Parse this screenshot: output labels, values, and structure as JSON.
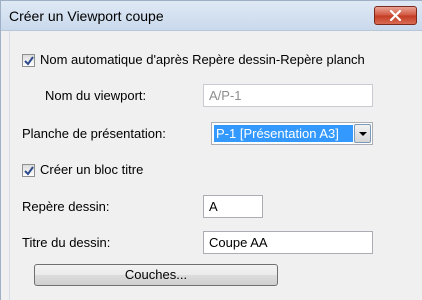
{
  "window": {
    "title": "Créer un Viewport coupe"
  },
  "auto_name": {
    "checked": true,
    "label": "Nom automatique d'après Repère dessin-Repère planch"
  },
  "viewport_name": {
    "label": "Nom du viewport:",
    "value": "A/P-1"
  },
  "sheet_layer": {
    "label": "Planche de présentation:",
    "selected": "P-1 [Présentation A3]"
  },
  "title_block": {
    "checked": true,
    "label": "Créer un bloc titre"
  },
  "drawing_mark": {
    "label": "Repère dessin:",
    "value": "A"
  },
  "drawing_title": {
    "label": "Titre du dessin:",
    "value": "Coupe AA"
  },
  "buttons": {
    "layers_label": "Couches..."
  },
  "icons": {
    "close": "close-icon",
    "checkmark": "checkmark-icon",
    "dropdown": "chevron-down-icon"
  },
  "colors": {
    "selection": "#3399ff",
    "close_button": "#c23b22",
    "titlebar": "#c9d9ec"
  }
}
